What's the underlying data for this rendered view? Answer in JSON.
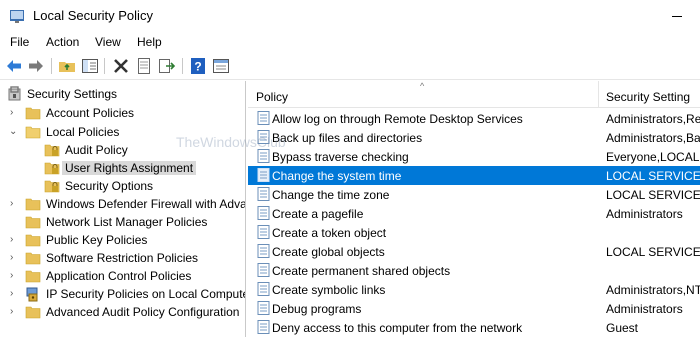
{
  "window": {
    "title": "Local Security Policy"
  },
  "menu": [
    "File",
    "Action",
    "View",
    "Help"
  ],
  "toolbar": {
    "buttons": [
      "back-icon",
      "forward-icon",
      "up-folder-icon",
      "show-hide-tree-icon",
      "delete-icon",
      "properties-icon",
      "export-list-icon",
      "help-icon",
      "console-icon"
    ]
  },
  "tree": {
    "items": [
      {
        "label": "Security Settings",
        "expander": "",
        "icon": "security-settings-icon"
      },
      {
        "label": "Account Policies",
        "expander": "›",
        "icon": "folder-icon"
      },
      {
        "label": "Local Policies",
        "expander": "⌄",
        "icon": "folder-open-icon"
      },
      {
        "label": "Audit Policy",
        "expander": "",
        "icon": "lock-folder-icon"
      },
      {
        "label": "User Rights Assignment",
        "expander": "",
        "icon": "lock-folder-icon"
      },
      {
        "label": "Security Options",
        "expander": "",
        "icon": "lock-folder-icon"
      },
      {
        "label": "Windows Defender Firewall with Adva",
        "expander": "›",
        "icon": "folder-icon"
      },
      {
        "label": "Network List Manager Policies",
        "expander": "",
        "icon": "folder-icon"
      },
      {
        "label": "Public Key Policies",
        "expander": "›",
        "icon": "folder-icon"
      },
      {
        "label": "Software Restriction Policies",
        "expander": "›",
        "icon": "folder-icon"
      },
      {
        "label": "Application Control Policies",
        "expander": "›",
        "icon": "folder-icon"
      },
      {
        "label": "IP Security Policies on Local Compute",
        "expander": "›",
        "icon": "ip-security-icon"
      },
      {
        "label": "Advanced Audit Policy Configuration",
        "expander": "›",
        "icon": "folder-icon"
      }
    ],
    "selected_label": "User Rights Assignment"
  },
  "list": {
    "columns": [
      "Policy",
      "Security Setting"
    ],
    "rows": [
      {
        "policy": "Allow log on through Remote Desktop Services",
        "setting": "Administrators,Re"
      },
      {
        "policy": "Back up files and directories",
        "setting": "Administrators,Ba"
      },
      {
        "policy": "Bypass traverse checking",
        "setting": "Everyone,LOCAL S"
      },
      {
        "policy": "Change the system time",
        "setting": "LOCAL SERVICE,A"
      },
      {
        "policy": "Change the time zone",
        "setting": "LOCAL SERVICE,A"
      },
      {
        "policy": "Create a pagefile",
        "setting": "Administrators"
      },
      {
        "policy": "Create a token object",
        "setting": ""
      },
      {
        "policy": "Create global objects",
        "setting": "LOCAL SERVICE,N"
      },
      {
        "policy": "Create permanent shared objects",
        "setting": ""
      },
      {
        "policy": "Create symbolic links",
        "setting": "Administrators,NT"
      },
      {
        "policy": "Debug programs",
        "setting": "Administrators"
      },
      {
        "policy": "Deny access to this computer from the network",
        "setting": "Guest"
      }
    ],
    "selected_policy": "Change the system time"
  },
  "watermark": "TheWindowsClub",
  "colors": {
    "selection": "#0078d7",
    "tree_selection": "#d9d9d9",
    "folder": "#e8c15a",
    "lock": "#c9a227"
  }
}
